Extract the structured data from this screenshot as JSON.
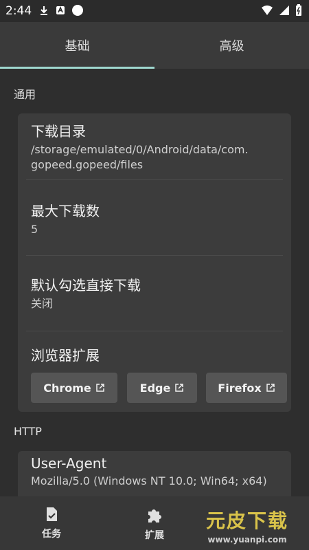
{
  "status": {
    "time": "2:44"
  },
  "tabs": [
    {
      "label": "基础",
      "active": true
    },
    {
      "label": "高级",
      "active": false
    }
  ],
  "sections": {
    "general": {
      "title": "通用",
      "download_dir": {
        "title": "下载目录",
        "value": "/storage/emulated/0/Android/data/com.gopeed.gopeed/files"
      },
      "max_downloads": {
        "title": "最大下载数",
        "value": "5"
      },
      "default_select": {
        "title": "默认勾选直接下载",
        "value": "关闭"
      },
      "browser_ext": {
        "title": "浏览器扩展",
        "buttons": [
          "Chrome",
          "Edge",
          "Firefox"
        ]
      }
    },
    "http": {
      "title": "HTTP",
      "user_agent": {
        "title": "User-Agent",
        "value": "Mozilla/5.0 (Windows NT 10.0; Win64; x64)"
      }
    }
  },
  "bottom_nav": [
    {
      "label": "任务",
      "icon": "task-icon"
    },
    {
      "label": "扩展",
      "icon": "puzzle-icon"
    }
  ],
  "watermark": {
    "text": "元皮下载",
    "url": "www.yuanpi.com"
  }
}
